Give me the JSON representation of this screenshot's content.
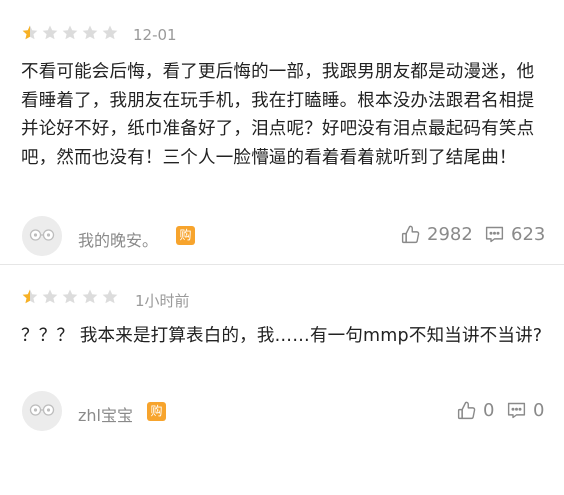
{
  "colors": {
    "star_active": "#f7b125",
    "star_inactive": "#dcdcdc",
    "badge": "#f7a42d",
    "meta": "#8a8a8a"
  },
  "reviews": [
    {
      "rating": 0.5,
      "date": "12-01",
      "content": "不看可能会后悔，看了更后悔的一部，我跟男朋友都是动漫迷，他看睡着了，我朋友在玩手机，我在打瞌睡。根本没办法跟君名相提并论好不好，纸巾准备好了，泪点呢？好吧没有泪点最起码有笑点吧，然而也没有！三个人一脸懵逼的看着看着就听到了结尾曲！",
      "username": "我的晚安。",
      "badge": "购",
      "likes": "2982",
      "comments": "623"
    },
    {
      "rating": 0.5,
      "date": "1小时前",
      "content": "？？？ 我本来是打算表白的，我……有一句mmp不知当讲不当讲?",
      "username": "zhl宝宝",
      "badge": "购",
      "likes": "0",
      "comments": "0"
    }
  ]
}
